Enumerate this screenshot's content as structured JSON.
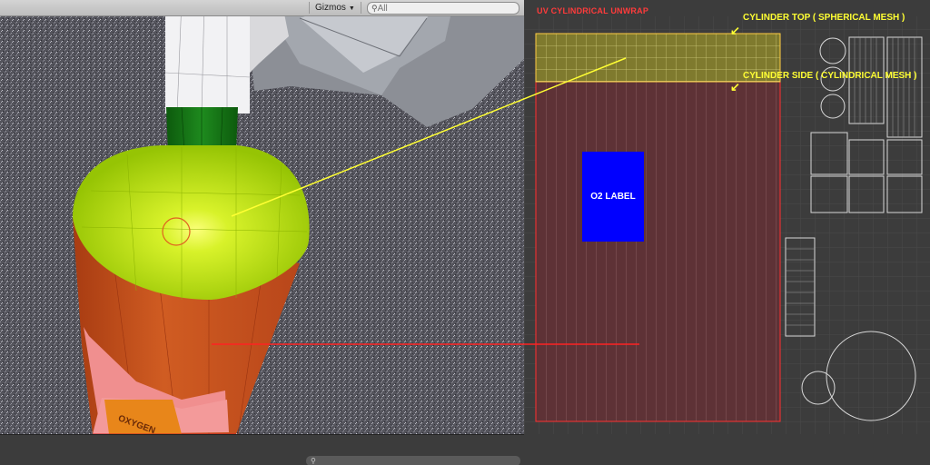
{
  "toolbar": {
    "gizmos_label": "Gizmos",
    "search_placeholder": "All"
  },
  "uv_panel": {
    "title": "UV CYLINDRICAL UNWRAP",
    "cylinder_top_label": "CYLINDER TOP ( SPHERICAL MESH )",
    "cylinder_side_label": "CYLINDER SIDE ( CYLINDRICAL MESH )",
    "o2_label": "O2 LABEL"
  },
  "bottle": {
    "sticker_text": "OXYGEN"
  },
  "colors": {
    "uv_top_region": "#7f7a2e",
    "uv_side_region": "#5e3236",
    "o2_label_fill": "#0000ff",
    "annotation_yellow": "#ffff33",
    "annotation_red": "#ff2222",
    "bottle_cap": "#b4e20a",
    "bottle_body": "#c8561c"
  }
}
